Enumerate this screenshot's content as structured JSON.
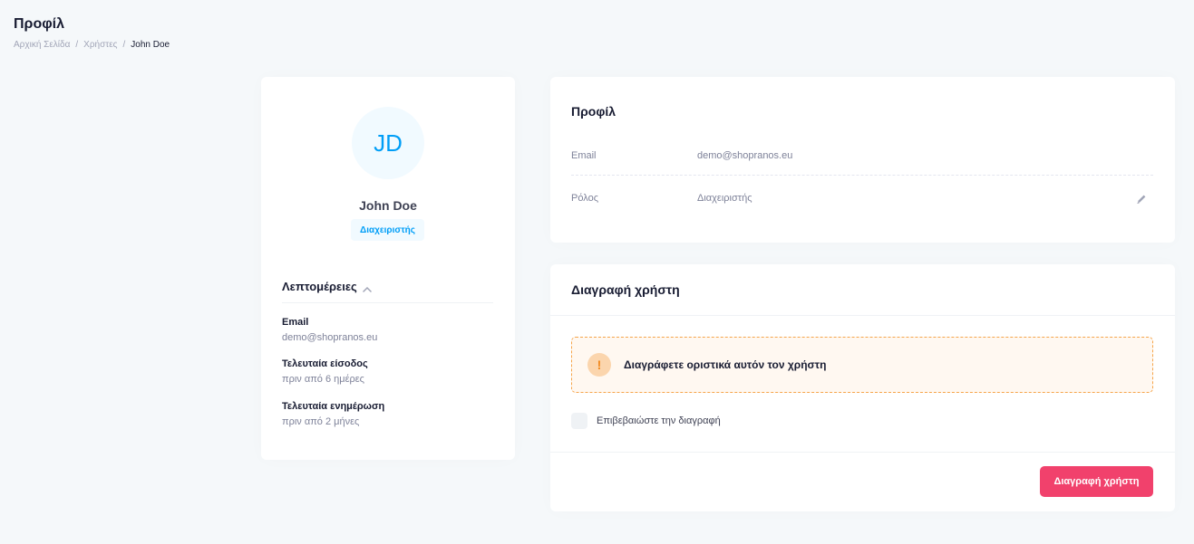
{
  "header": {
    "title": "Προφίλ",
    "breadcrumb": {
      "home": "Αρχική Σελίδα",
      "sep": "/",
      "users": "Χρήστες",
      "current": "John Doe"
    }
  },
  "user_card": {
    "initials": "JD",
    "name": "John Doe",
    "role_badge": "Διαχειριστής",
    "details_title": "Λεπτομέρειες",
    "details": [
      {
        "label": "Email",
        "value": "demo@shopranos.eu"
      },
      {
        "label": "Τελευταία είσοδος",
        "value": "πριν από 6 ημέρες"
      },
      {
        "label": "Τελευταία ενημέρωση",
        "value": "πριν από 2 μήνες"
      }
    ]
  },
  "profile_card": {
    "title": "Προφίλ",
    "rows": [
      {
        "label": "Email",
        "value": "demo@shopranos.eu"
      },
      {
        "label": "Ρόλος",
        "value": "Διαχειριστής"
      }
    ],
    "edit_icon": "pencil-icon"
  },
  "delete_card": {
    "title": "Διαγραφή χρήστη",
    "warning_icon": "exclamation-icon",
    "warning_mark": "!",
    "warning_text": "Διαγράφετε οριστικά αυτόν τον χρήστη",
    "confirm_label": "Επιβεβαιώστε την διαγραφή",
    "confirm_checked": false,
    "button_label": "Διαγραφή χρήστη"
  },
  "colors": {
    "primary": "#009ef7",
    "danger": "#f1416c",
    "warning": "#f6a54a",
    "background": "#f5f8fa"
  }
}
